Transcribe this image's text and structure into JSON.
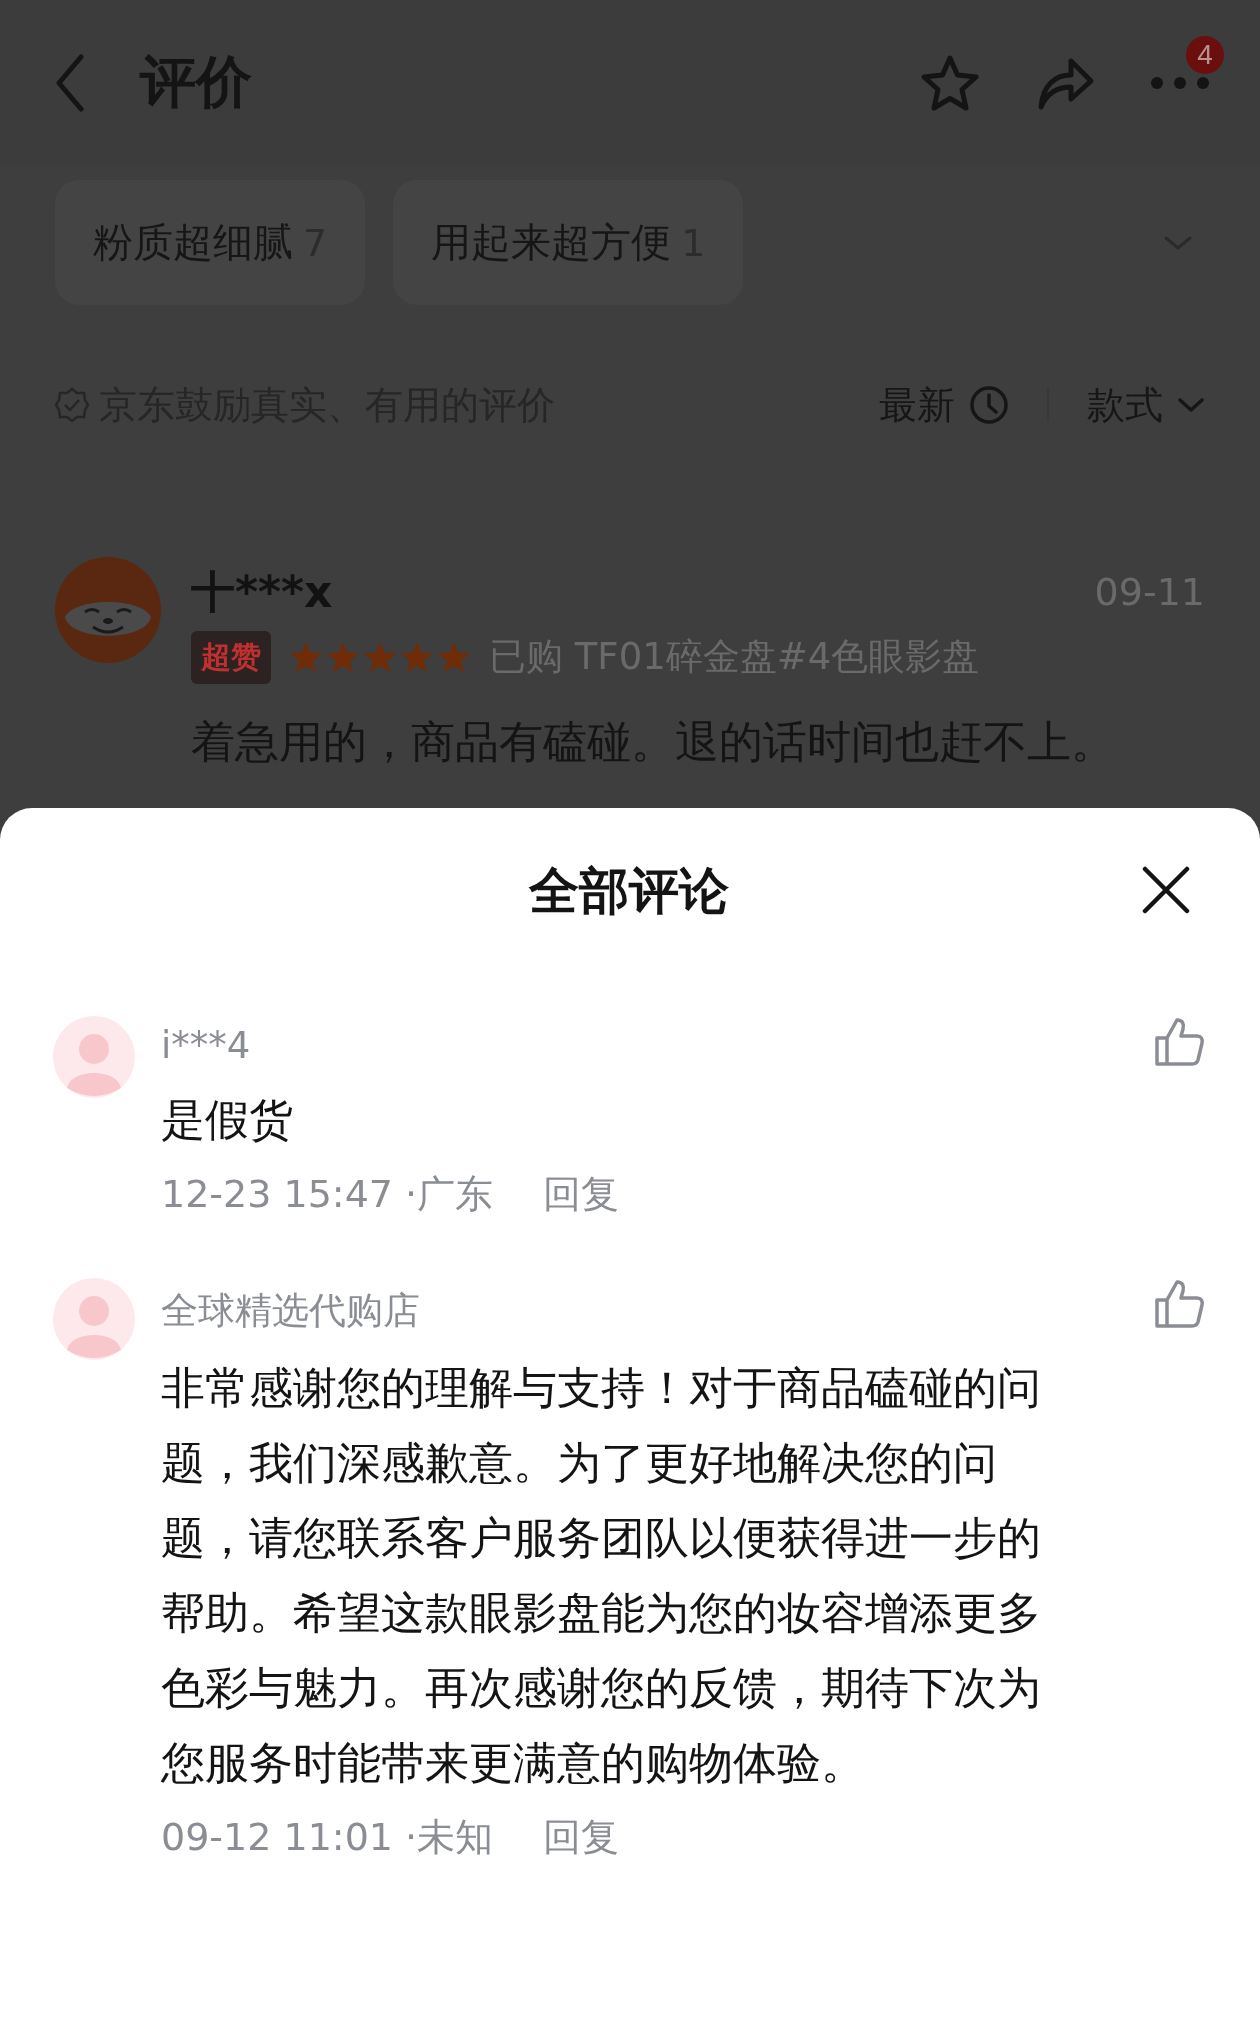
{
  "header": {
    "title": "评价",
    "badge": "4"
  },
  "tags": [
    {
      "label": "粉质超细腻",
      "count": "7"
    },
    {
      "label": "用起来超方便",
      "count": "1"
    }
  ],
  "notice": "京东鼓励真实、有用的评价",
  "sort": {
    "label": "最新"
  },
  "filter": {
    "label": "款式"
  },
  "review": {
    "user": "十***x",
    "date": "09-11",
    "badge": "超赞",
    "stars": 5,
    "purchase": "已购 TF01碎金盘#4色眼影盘",
    "text": "着急用的，商品有磕碰。退的话时间也赶不上。"
  },
  "sheet": {
    "title": "全部评论",
    "comments": [
      {
        "user": "i***4",
        "text": "是假货",
        "meta": "12-23 15:47 ·广东",
        "reply": "回复"
      },
      {
        "user": "全球精选代购店",
        "text": "非常感谢您的理解与支持！对于商品磕碰的问题，我们深感歉意。为了更好地解决您的问题，请您联系客户服务团队以便获得进一步的帮助。希望这款眼影盘能为您的妆容增添更多色彩与魅力。再次感谢您的反馈，期待下次为您服务时能带来更满意的购物体验。",
        "meta": "09-12 11:01 ·未知",
        "reply": "回复"
      }
    ]
  }
}
